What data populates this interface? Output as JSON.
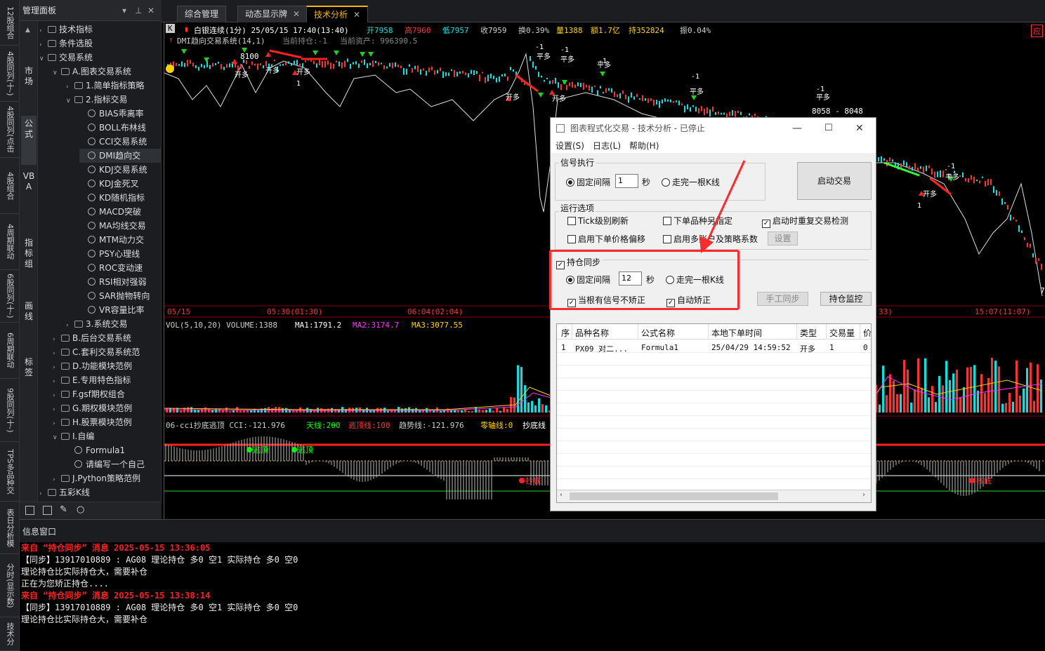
{
  "side_tabs": [
    "12股组合",
    "4股同列(十-)",
    "4股同列(点击",
    "4股组合",
    "4周期联动",
    "6股同列(十-)",
    "6周期联动",
    "9股同列(十-)",
    "TPS多品种交",
    "表日分析模",
    "分时(显示数)",
    "技术分"
  ],
  "panel": {
    "title": "管理面板",
    "categories": [
      {
        "label": "市场"
      },
      {
        "label": "公式"
      },
      {
        "label": "VBA"
      },
      {
        "label": "指标组"
      },
      {
        "label": "画线"
      },
      {
        "label": "标签"
      }
    ],
    "tree": [
      {
        "label": "技术指标",
        "level": 0,
        "expand": ">"
      },
      {
        "label": "条件选股",
        "level": 0,
        "expand": ">"
      },
      {
        "label": "交易系统",
        "level": 0,
        "expand": "v"
      },
      {
        "label": "A.图表交易系统",
        "level": 1,
        "expand": "v"
      },
      {
        "label": "1.简单指标策略",
        "level": 2,
        "expand": ">"
      },
      {
        "label": "2.指标交易",
        "level": 2,
        "expand": "v"
      },
      {
        "label": "BIAS乖离率",
        "level": 3,
        "expand": ""
      },
      {
        "label": "BOLL布林线",
        "level": 3,
        "expand": ""
      },
      {
        "label": "CCI交易系统",
        "level": 3,
        "expand": ""
      },
      {
        "label": "DMI趋向交",
        "level": 3,
        "expand": "",
        "selected": true
      },
      {
        "label": "KDJ交易系统",
        "level": 3,
        "expand": ""
      },
      {
        "label": "KDJ金死叉",
        "level": 3,
        "expand": ""
      },
      {
        "label": "KD随机指标",
        "level": 3,
        "expand": ""
      },
      {
        "label": "MACD突破",
        "level": 3,
        "expand": ""
      },
      {
        "label": "MA均线交易",
        "level": 3,
        "expand": ""
      },
      {
        "label": "MTM动力交",
        "level": 3,
        "expand": ""
      },
      {
        "label": "PSY心理线",
        "level": 3,
        "expand": ""
      },
      {
        "label": "ROC变动速",
        "level": 3,
        "expand": ""
      },
      {
        "label": "RSI相对强弱",
        "level": 3,
        "expand": ""
      },
      {
        "label": "SAR抛物转向",
        "level": 3,
        "expand": ""
      },
      {
        "label": "VR容量比率",
        "level": 3,
        "expand": ""
      },
      {
        "label": "3.系统交易",
        "level": 2,
        "expand": ">"
      },
      {
        "label": "B.后台交易系统",
        "level": 1,
        "expand": ">"
      },
      {
        "label": "C.套利交易系统范",
        "level": 1,
        "expand": ">"
      },
      {
        "label": "D.功能模块范例",
        "level": 1,
        "expand": ">"
      },
      {
        "label": "E.专用特色指标",
        "level": 1,
        "expand": ">"
      },
      {
        "label": "F.gsf期权组合",
        "level": 1,
        "expand": ">"
      },
      {
        "label": "G.期权模块范例",
        "level": 1,
        "expand": ">"
      },
      {
        "label": "H.股票模块范例",
        "level": 1,
        "expand": ">"
      },
      {
        "label": "I.自编",
        "level": 1,
        "expand": "v"
      },
      {
        "label": "Formula1",
        "level": 2,
        "expand": ""
      },
      {
        "label": "请编写一个自己",
        "level": 2,
        "expand": ""
      },
      {
        "label": "J.Python策略范例",
        "level": 1,
        "expand": ">"
      },
      {
        "label": "五彩K线",
        "level": 0,
        "expand": ">"
      }
    ]
  },
  "tabs": [
    {
      "label": "综合管理",
      "active": false
    },
    {
      "label": "动态显示牌",
      "active": false
    },
    {
      "label": "技术分析",
      "active": true
    }
  ],
  "chart": {
    "period_badge": "K",
    "header": {
      "name": "白银连续(1分) 25/05/15 17:40(13:40)",
      "open": "开7958",
      "high": "高7960",
      "low": "低7957",
      "close": "收7959",
      "turnover": "换0.39%",
      "volume": "量1388",
      "amount": "额1.7亿",
      "position": "持352824",
      "amplitude": "振0.04%"
    },
    "right_tag": "应",
    "system_line": "DMI趋向交易系统(14,1)",
    "cur_pos": "当前持仓:-1",
    "cur_asset": "当前资产: 996390.5",
    "price_8100": "8100",
    "price_range": "8058 - 8048",
    "right_value": "7",
    "signal_open": "开多",
    "signal_close": "平多",
    "signal_m1": "-1",
    "signal_1": "1",
    "time_axis": [
      "05/15",
      "05:30(01:30)",
      "06:04(02:04)",
      "33)",
      "15:07(11:07)"
    ],
    "vol_line": {
      "title": "VOL(5,10,20) VOLUME:1388",
      "ma1": "MA1:1791.2",
      "ma2": "MA2:3174.7",
      "ma3": "MA3:3077.55"
    },
    "cci_line": {
      "title": "06-cci抄底逃顶 CCI:-121.976",
      "sky": "天线:200",
      "escape": "逃顶线:100",
      "trend": "趋势线:-121.976",
      "zero": "零轴线:0",
      "bottom": "抄底线"
    },
    "cci_escape_label": "逃顶",
    "cci_bottom_label": "抄底",
    "colors": {
      "up": "#ff3030",
      "down": "#00e5e5",
      "ma1": "#ffffff",
      "ma2": "#ff30ff",
      "ma3": "#ffd200",
      "signal_up": "#ff2020",
      "signal_down": "#20d020"
    }
  },
  "dialog": {
    "title": "图表程式化交易 - 技术分析 - 已停止",
    "menu": [
      "设置(S)",
      "日志(L)",
      "帮助(H)"
    ],
    "signal_group": "信号执行",
    "fixed_interval": "固定间隔",
    "interval_value": "1",
    "seconds": "秒",
    "per_bar": "走完一根K线",
    "start_button": "启动交易",
    "run_group": "运行选项",
    "opt_tick": "Tick级别刷新",
    "opt_assign": "下单品种另指定",
    "opt_check": "启动时重复交易检测",
    "opt_offset": "启用下单价格偏移",
    "opt_multi": "启用多账户及策略系数",
    "setting_button": "设置",
    "sync_group": "持仓同步",
    "sync_interval_value": "12",
    "opt_no_signal": "当根有信号不矫正",
    "opt_auto": "自动矫正",
    "manual_sync_button": "手工同步",
    "monitor_button": "持仓监控",
    "table": {
      "headers": [
        "序",
        "品种名称",
        "公式名称",
        "本地下单时间",
        "类型",
        "交易量",
        "价"
      ],
      "rows": [
        [
          "1",
          "PX09 对二...",
          "Formula1",
          "25/04/29 14:59:52",
          "开多",
          "1",
          "0"
        ]
      ]
    }
  },
  "info": {
    "title": "信息窗口",
    "messages": [
      {
        "text": "来自 “持仓同步” 消息 2025-05-15 13:36:05",
        "kind": "red"
      },
      {
        "text": "【同步】13917010889 : AG08 理论持仓 多0 空1 实际持仓 多0 空0",
        "kind": "white"
      },
      {
        "text": "理论持仓比实际持仓大，需要补仓",
        "kind": "white"
      },
      {
        "text": "正在为您矫正持仓....",
        "kind": "white"
      },
      {
        "text": "来自 “持仓同步” 消息 2025-05-15 13:38:14",
        "kind": "red"
      },
      {
        "text": "【同步】13917010889 : AG08 理论持仓 多0 空1 实际持仓 多0 空0",
        "kind": "white"
      },
      {
        "text": "理论持仓比实际持仓大，需要补仓",
        "kind": "white"
      }
    ]
  }
}
